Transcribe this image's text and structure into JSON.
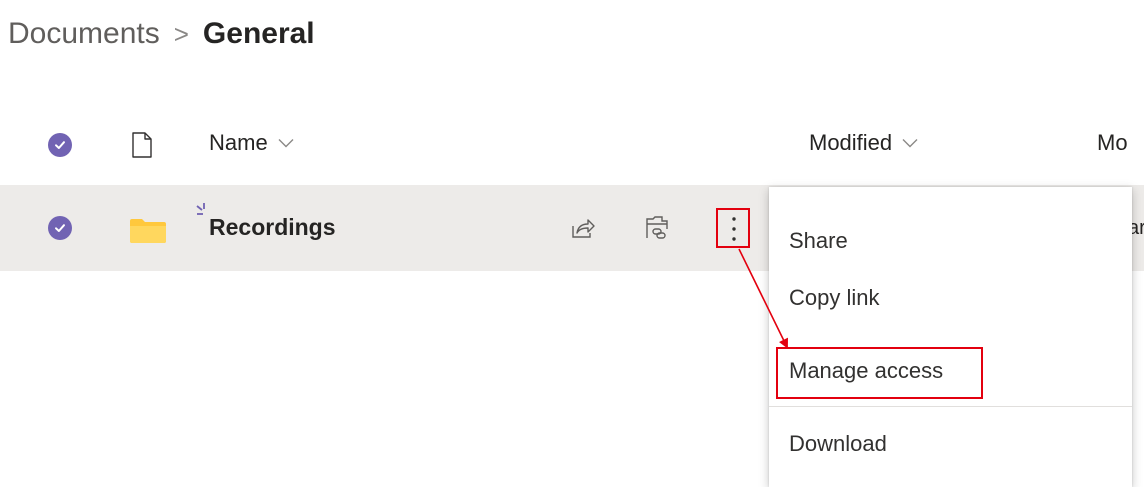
{
  "breadcrumb": {
    "root": "Documents",
    "separator": ">",
    "current": "General"
  },
  "header": {
    "name_label": "Name",
    "modified_label": "Modified",
    "modified_by_label_cut": "Mo"
  },
  "row": {
    "name": "Recordings",
    "truncated_modified_by": "ar",
    "selected": true,
    "folder_color": "#ffc83d"
  },
  "context_menu": {
    "items": [
      {
        "label": "Share"
      },
      {
        "label": "Copy link"
      },
      {
        "label": "Manage access",
        "highlighted": true
      },
      {
        "label": "Download"
      }
    ]
  },
  "colors": {
    "accent": "#7163b3",
    "row_selected_bg": "#edebe9",
    "annotation": "#e3000f"
  }
}
